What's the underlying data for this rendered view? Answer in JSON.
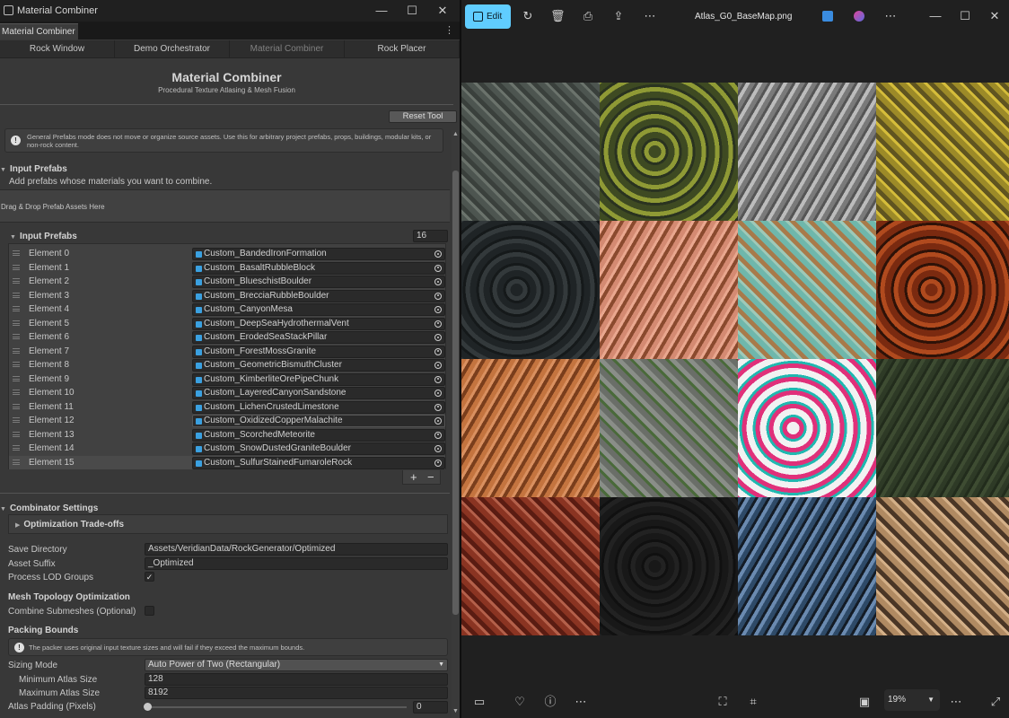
{
  "window": {
    "title": "Material Combiner",
    "minimize_glyph": "—",
    "maximize_glyph": "☐",
    "close_glyph": "✕"
  },
  "dock": {
    "active_tab": "Material Combiner",
    "menu_glyph": "⋮"
  },
  "subtabs": [
    {
      "label": "Rock Window"
    },
    {
      "label": "Demo Orchestrator"
    },
    {
      "label": "Material Combiner"
    },
    {
      "label": "Rock Placer"
    }
  ],
  "header": {
    "title": "Material Combiner",
    "subtitle": "Procedural Texture Atlasing & Mesh Fusion"
  },
  "reset_label": "Reset Tool",
  "info_text": "General Prefabs mode does not move or organize source assets. Use this for arbitrary project prefabs, props, buildings, modular kits, or non-rock content.",
  "input_prefabs": {
    "section_title": "Input Prefabs",
    "description": "Add prefabs whose materials you want to combine.",
    "dropzone_text": "Drag & Drop Prefab Assets Here",
    "list_title": "Input Prefabs",
    "count": "16",
    "elements": [
      {
        "label": "Element 0",
        "value": "Custom_BandedIronFormation"
      },
      {
        "label": "Element 1",
        "value": "Custom_BasaltRubbleBlock"
      },
      {
        "label": "Element 2",
        "value": "Custom_BlueschistBoulder"
      },
      {
        "label": "Element 3",
        "value": "Custom_BrecciaRubbleBoulder"
      },
      {
        "label": "Element 4",
        "value": "Custom_CanyonMesa"
      },
      {
        "label": "Element 5",
        "value": "Custom_DeepSeaHydrothermalVent"
      },
      {
        "label": "Element 6",
        "value": "Custom_ErodedSeaStackPillar"
      },
      {
        "label": "Element 7",
        "value": "Custom_ForestMossGranite"
      },
      {
        "label": "Element 8",
        "value": "Custom_GeometricBismuthCluster"
      },
      {
        "label": "Element 9",
        "value": "Custom_KimberliteOrePipeChunk"
      },
      {
        "label": "Element 10",
        "value": "Custom_LayeredCanyonSandstone"
      },
      {
        "label": "Element 11",
        "value": "Custom_LichenCrustedLimestone"
      },
      {
        "label": "Element 12",
        "value": "Custom_OxidizedCopperMalachite"
      },
      {
        "label": "Element 13",
        "value": "Custom_ScorchedMeteorite"
      },
      {
        "label": "Element 14",
        "value": "Custom_SnowDustedGraniteBoulder"
      },
      {
        "label": "Element 15",
        "value": "Custom_SulfurStainedFumaroleRock"
      }
    ],
    "add_glyph": "+",
    "remove_glyph": "−"
  },
  "combinator": {
    "section_title": "Combinator Settings",
    "tradeoffs_label": "Optimization Trade-offs",
    "save_dir_label": "Save Directory",
    "save_dir_value": "Assets/VeridianData/RockGenerator/Optimized",
    "suffix_label": "Asset Suffix",
    "suffix_value": "_Optimized",
    "lod_label": "Process LOD Groups",
    "lod_checked": true,
    "mesh_topology_label": "Mesh Topology Optimization",
    "submeshes_label": "Combine Submeshes (Optional)",
    "submeshes_checked": false,
    "packing_label": "Packing Bounds",
    "packing_info": "The packer uses original input texture sizes and will fail if they exceed the maximum bounds.",
    "sizing_label": "Sizing Mode",
    "sizing_value": "Auto Power of Two (Rectangular)",
    "min_label": "Minimum Atlas Size",
    "min_value": "128",
    "max_label": "Maximum Atlas Size",
    "max_value": "8192",
    "padding_label": "Atlas Padding (Pixels)",
    "padding_value": "0",
    "padding_fraction": 0
  },
  "viewer": {
    "edit_label": "Edit",
    "filename": "Atlas_G0_BaseMap.png",
    "zoom": "19%",
    "icons": [
      "rotate-icon",
      "delete-icon",
      "print-icon",
      "share-icon",
      "more-icon",
      "designer-icon",
      "copilot-icon",
      "more-icon"
    ],
    "tiles": [
      {
        "name": "grey-slate",
        "c1": "#4d5550",
        "c2": "#6b736c",
        "c3": "#3a403c"
      },
      {
        "name": "green-yellow-hex",
        "c1": "#3e4a22",
        "c2": "#8f9a35",
        "c3": "#2a3320"
      },
      {
        "name": "grey-white-speckle",
        "c1": "#7a7a7a",
        "c2": "#bcbcbc",
        "c3": "#555555"
      },
      {
        "name": "gold-hex",
        "c1": "#9c8a28",
        "c2": "#d4bc3a",
        "c3": "#5f5420"
      },
      {
        "name": "dark-charcoal",
        "c1": "#1f2426",
        "c2": "#33393b",
        "c3": "#15191a"
      },
      {
        "name": "pink-brown-bands",
        "c1": "#d48a72",
        "c2": "#8a4a2e",
        "c3": "#e9a78f"
      },
      {
        "name": "teal-hex",
        "c1": "#6fb7ab",
        "c2": "#9ec9b8",
        "c3": "#a87a4a"
      },
      {
        "name": "rust-hex",
        "c1": "#7a2a10",
        "c2": "#b04a1e",
        "c3": "#2e1208"
      },
      {
        "name": "orange-bands",
        "c1": "#c4743f",
        "c2": "#7a3e1c",
        "c3": "#d99060"
      },
      {
        "name": "grey-moss",
        "c1": "#6a6e68",
        "c2": "#4a6a3a",
        "c3": "#8a8e88"
      },
      {
        "name": "white-confetti",
        "c1": "#f2f2f2",
        "c2": "#e0307a",
        "c3": "#20b8b0"
      },
      {
        "name": "dark-green-camo",
        "c1": "#2e3a26",
        "c2": "#3e4c32",
        "c3": "#222c1c"
      },
      {
        "name": "red-grain",
        "c1": "#8a3422",
        "c2": "#b4604a",
        "c3": "#5a1c12"
      },
      {
        "name": "near-black",
        "c1": "#181818",
        "c2": "#222222",
        "c3": "#101010"
      },
      {
        "name": "blue-swirl",
        "c1": "#2e4a68",
        "c2": "#6a8ab0",
        "c3": "#141c26"
      },
      {
        "name": "tan-speckle",
        "c1": "#b08a62",
        "c2": "#d4b088",
        "c3": "#4a3626"
      }
    ]
  }
}
